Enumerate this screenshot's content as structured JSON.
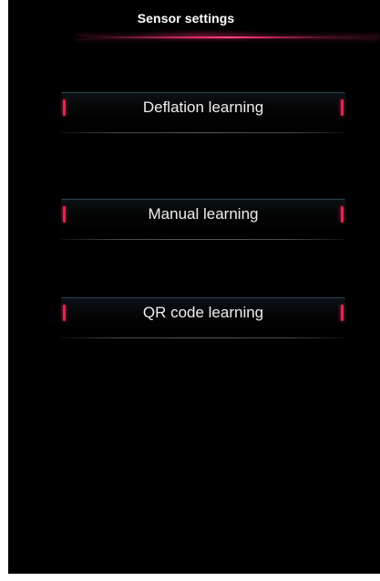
{
  "header": {
    "title": "Sensor settings"
  },
  "menu": {
    "items": [
      {
        "label": "Deflation learning"
      },
      {
        "label": "Manual learning"
      },
      {
        "label": "QR code learning"
      }
    ]
  },
  "colors": {
    "background": "#000000",
    "accent": "#e0254f",
    "text": "#eeeeee"
  }
}
